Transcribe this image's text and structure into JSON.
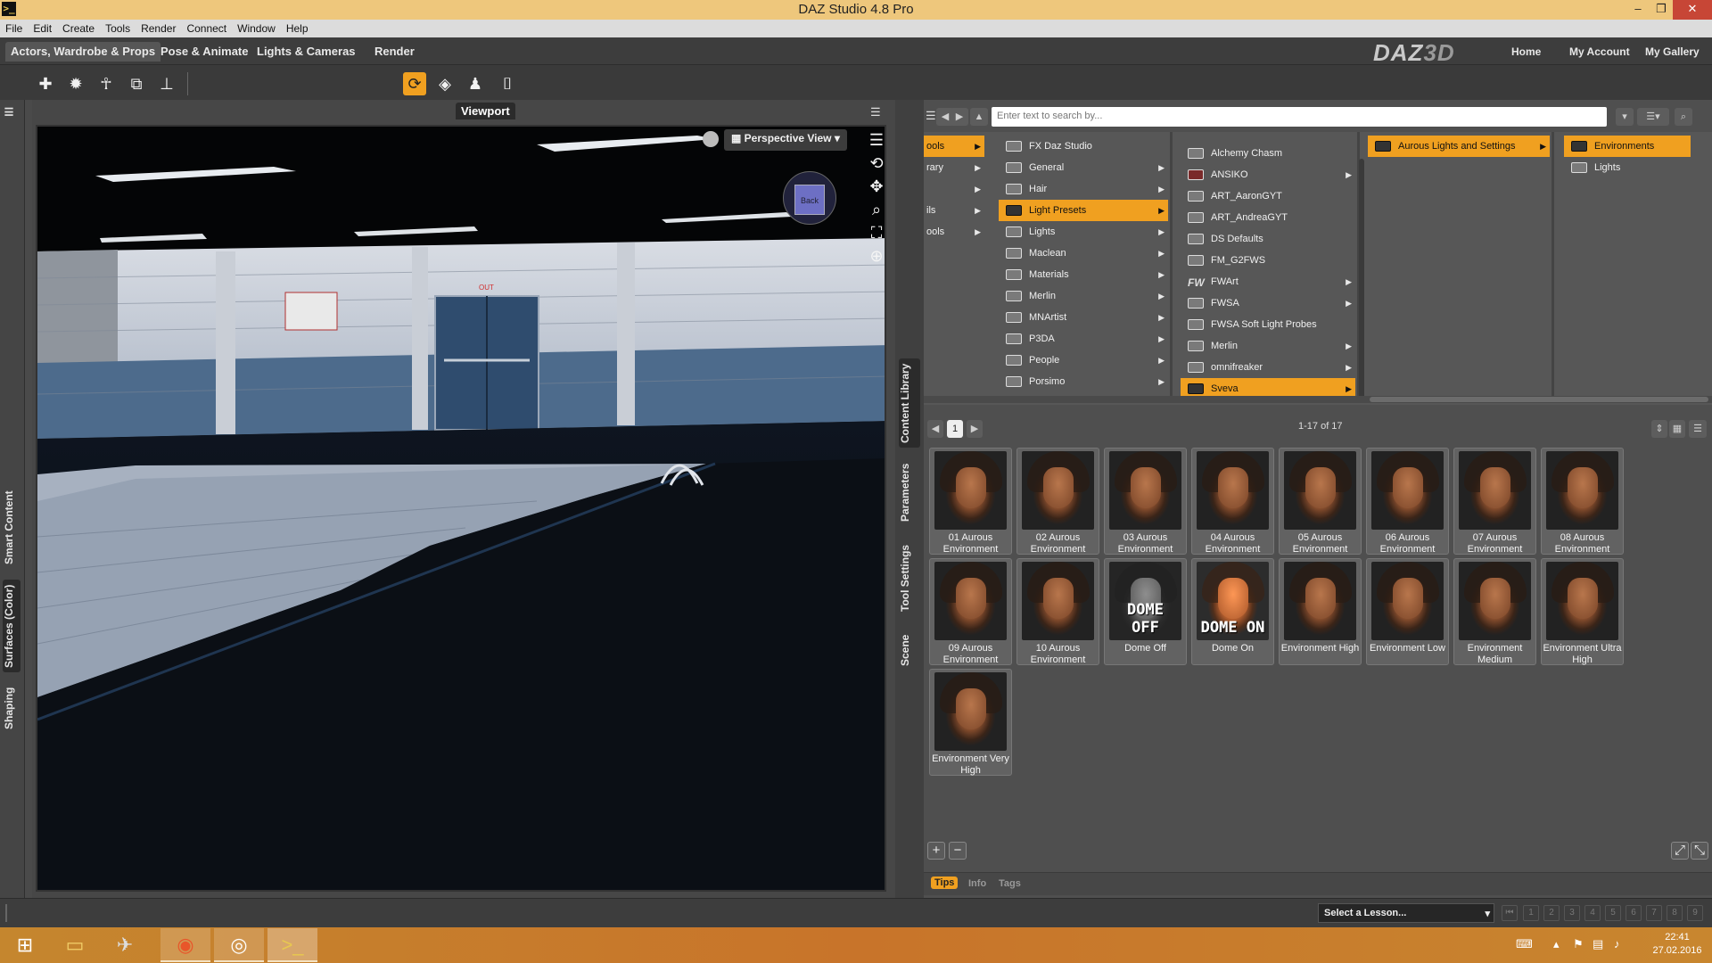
{
  "window": {
    "title": "DAZ Studio 4.8 Pro",
    "minimize": "–",
    "maximize": "❐",
    "close": "✕"
  },
  "menu": [
    "File",
    "Edit",
    "Create",
    "Tools",
    "Render",
    "Connect",
    "Window",
    "Help"
  ],
  "activity_tabs": [
    "Actors, Wardrobe & Props",
    "Pose & Animate",
    "Lights & Cameras",
    "Render"
  ],
  "brand": {
    "logo_a": "DAZ",
    "logo_b": "3D"
  },
  "top_links": [
    "Home",
    "My Account",
    "My Gallery"
  ],
  "left_tabs": [
    "Smart Content",
    "Surfaces (Color)",
    "Shaping"
  ],
  "viewport": {
    "tab": "Viewport",
    "view_label": "Perspective View",
    "cube_label": "Back",
    "exit_sign": "OUT"
  },
  "mid_tabs": [
    "Content Library",
    "Parameters",
    "Tool Settings",
    "Scene"
  ],
  "content_library": {
    "search_placeholder": "Enter text to search by...",
    "col1": [
      "ools",
      "rary",
      "",
      "ils",
      "ools"
    ],
    "col2": [
      "FX Daz Studio",
      "General",
      "Hair",
      "Light Presets",
      "Lights",
      "Maclean",
      "Materials",
      "Merlin",
      "MNArtist",
      "P3DA",
      "People",
      "Porsimo"
    ],
    "col3": [
      "Alchemy Chasm",
      "ANSIKO",
      "ART_AaronGYT",
      "ART_AndreaGYT",
      "DS Defaults",
      "FM_G2FWS",
      "FWArt",
      "FWSA",
      "FWSA Soft Light Probes",
      "Merlin",
      "omnifreaker",
      "Sveva"
    ],
    "col4": [
      "Aurous Lights and Settings"
    ],
    "col5": [
      "Environments",
      "Lights"
    ],
    "page": "1",
    "count": "1-17 of 17",
    "items": [
      {
        "label": "01 Aurous Environment"
      },
      {
        "label": "02 Aurous Environment"
      },
      {
        "label": "03 Aurous Environment"
      },
      {
        "label": "04 Aurous Environment"
      },
      {
        "label": "05 Aurous Environment"
      },
      {
        "label": "06 Aurous Environment"
      },
      {
        "label": "07 Aurous Environment"
      },
      {
        "label": "08 Aurous Environment"
      },
      {
        "label": "09 Aurous Environment"
      },
      {
        "label": "10 Aurous Environment"
      },
      {
        "label": "Dome Off",
        "overlay": "DOME OFF"
      },
      {
        "label": "Dome On",
        "overlay": "DOME ON"
      },
      {
        "label": "Environment High"
      },
      {
        "label": "Environment Low"
      },
      {
        "label": "Environment Medium"
      },
      {
        "label": "Environment Ultra High"
      },
      {
        "label": "Environment Very High"
      }
    ],
    "info_tabs": [
      "Tips",
      "Info",
      "Tags"
    ]
  },
  "status": {
    "lesson_placeholder": "Select a Lesson...",
    "lesson_numbers": [
      "1",
      "2",
      "3",
      "4",
      "5",
      "6",
      "7",
      "8",
      "9"
    ]
  },
  "taskbar": {
    "time": "22:41",
    "date": "27.02.2016"
  },
  "colors": {
    "accent": "#f0a020",
    "titlebar": "#eec77c",
    "taskbar": "#c8762b",
    "panel": "#4f4f4f"
  }
}
